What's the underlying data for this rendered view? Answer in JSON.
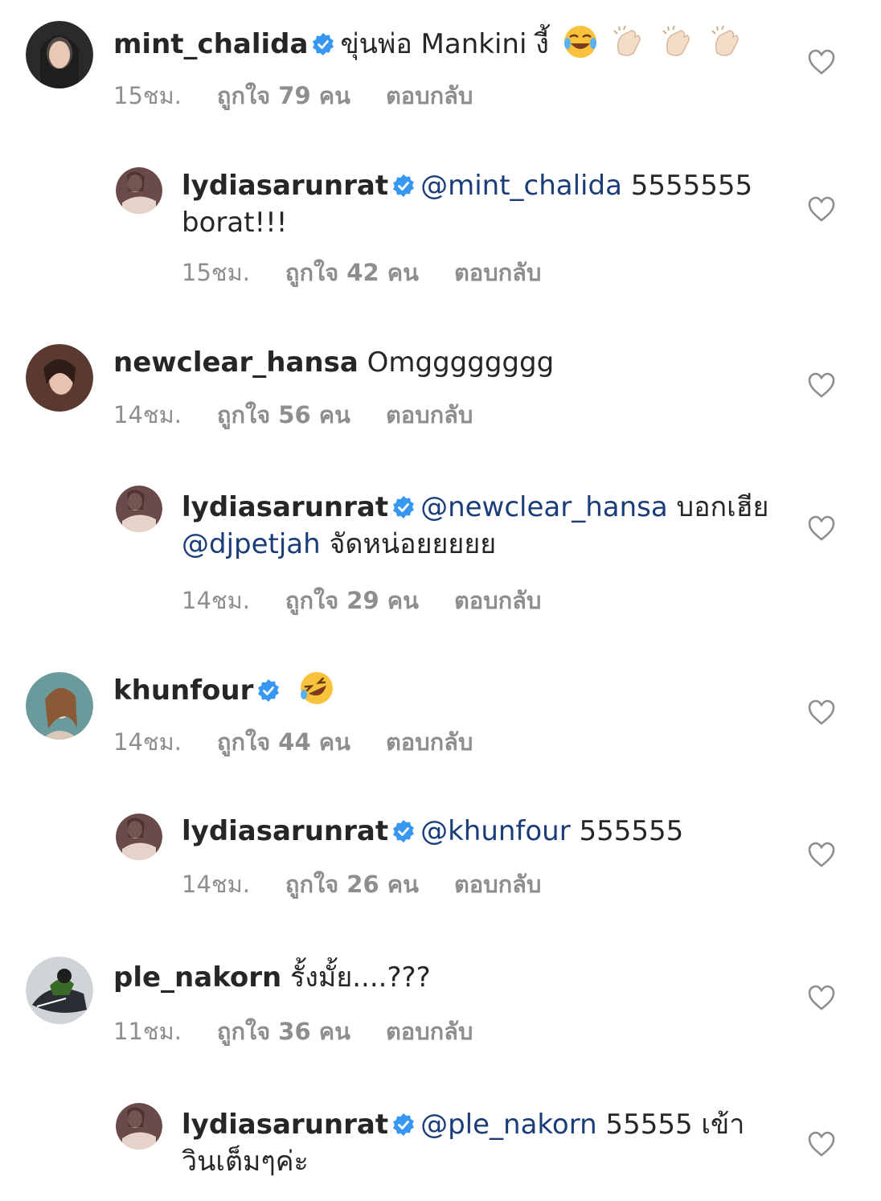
{
  "colors": {
    "text": "#262626",
    "meta": "#8e8e8e",
    "mention": "#1a3d7a",
    "verified": "#3897f0"
  },
  "comments": [
    {
      "username": "mint_chalida",
      "verified": true,
      "mention": "",
      "text": "ขุ่นพ่อ Mankini งี้",
      "emojis": [
        "face-with-tears-of-joy",
        "clapping-hands",
        "clapping-hands",
        "clapping-hands"
      ],
      "time": "15ชม.",
      "likes": "ถูกใจ 79 คน",
      "reply": "ตอบกลับ",
      "is_reply": false
    },
    {
      "username": "lydiasarunrat",
      "verified": true,
      "mention": "@mint_chalida",
      "text": " 5555555 borat!!!",
      "emojis": [],
      "time": "15ชม.",
      "likes": "ถูกใจ 42 คน",
      "reply": "ตอบกลับ",
      "is_reply": true
    },
    {
      "username": "newclear_hansa",
      "verified": false,
      "mention": "",
      "text": "Omgggggggg",
      "emojis": [],
      "time": "14ชม.",
      "likes": "ถูกใจ 56 คน",
      "reply": "ตอบกลับ",
      "is_reply": false
    },
    {
      "username": "lydiasarunrat",
      "verified": true,
      "mention": "@newclear_hansa",
      "text": " บอกเฮีย ",
      "mention2": "@djpetjah",
      "text2": " จัดหน่อยยยยย",
      "emojis": [],
      "time": "14ชม.",
      "likes": "ถูกใจ 29 คน",
      "reply": "ตอบกลับ",
      "is_reply": true
    },
    {
      "username": "khunfour",
      "verified": true,
      "mention": "",
      "text": "",
      "emojis": [
        "rolling-on-floor-laughing"
      ],
      "time": "14ชม.",
      "likes": "ถูกใจ 44 คน",
      "reply": "ตอบกลับ",
      "is_reply": false
    },
    {
      "username": "lydiasarunrat",
      "verified": true,
      "mention": "@khunfour",
      "text": " 555555",
      "emojis": [],
      "time": "14ชม.",
      "likes": "ถูกใจ 26 คน",
      "reply": "ตอบกลับ",
      "is_reply": true
    },
    {
      "username": "ple_nakorn",
      "verified": false,
      "mention": "",
      "text": "รั้งมั้ย....???",
      "emojis": [],
      "time": "11ชม.",
      "likes": "ถูกใจ 36 คน",
      "reply": "ตอบกลับ",
      "is_reply": false
    },
    {
      "username": "lydiasarunrat",
      "verified": true,
      "mention": "@ple_nakorn",
      "text": " 55555 เข้าวินเต็มๆค่ะ",
      "emojis": [],
      "time": "",
      "likes": "",
      "reply": "",
      "is_reply": true
    }
  ],
  "icons": {
    "verified": "verified-badge-icon",
    "like": "heart-outline-icon"
  }
}
